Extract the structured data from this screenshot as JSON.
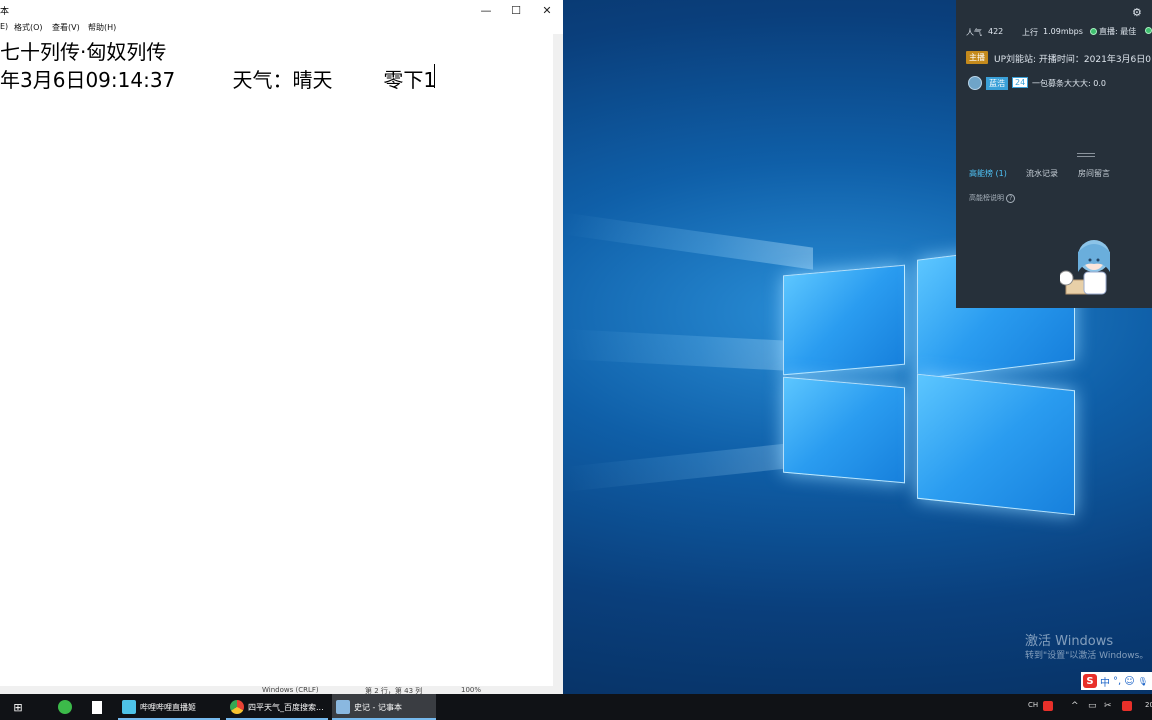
{
  "notepad": {
    "title": "本",
    "menu": [
      "E)",
      "格式(O)",
      "查看(V)",
      "帮助(H)"
    ],
    "lines": [
      "七十列传·匈奴列传",
      "年3月6日09:14:37         天气：晴天        零下1"
    ],
    "status": {
      "encoding": "Windows (CRLF)",
      "position": "第 2 行，第 43 列",
      "zoom": "100%"
    },
    "controls": {
      "minimize": "—",
      "maximize": "☐",
      "close": "✕"
    }
  },
  "live_panel": {
    "popularity_label": "人气",
    "popularity_value": "422",
    "upload_label": "上行",
    "upload_value": "1.09mbps",
    "live_label": "直播: 最佳",
    "host_badge": "主播",
    "host_line": "UP刘能站: 开播时间：2021年3月6日0",
    "fan_badge": "蓝浩",
    "fan_level": "24",
    "fan_line": "一包募条大大大: 0.0",
    "tabs": [
      "高能榜 (1)",
      "流水记录",
      "房间留言"
    ],
    "high_energy_note": "高能榜说明",
    "settings_icon": "gear-icon"
  },
  "watermark": {
    "line1": "激活 Windows",
    "line2": "转到\"设置\"以激活 Windows。"
  },
  "ime": {
    "logo": "S",
    "lang": "中",
    "punct": "°,",
    "emoji": "☺",
    "mic": "🎙"
  },
  "taskbar": {
    "apps": [
      {
        "label": "哔哩哔哩直播姬",
        "icon": "bilibili-live-icon",
        "color": "#4ec3e8"
      },
      {
        "label": "四平天气_百度搜索...",
        "icon": "chrome-icon",
        "color": "#e8b020"
      },
      {
        "label": "史记 - 记事本",
        "icon": "notepad-icon",
        "color": "#8ab8e0"
      }
    ],
    "tray_lang": "CH",
    "tray_caret": "^",
    "clock": "20"
  },
  "colors": {
    "panel_bg": "#26303a",
    "taskbar_bg": "#101216",
    "accent_blue": "#76b9ed",
    "tab_active": "#4fc3f7"
  }
}
